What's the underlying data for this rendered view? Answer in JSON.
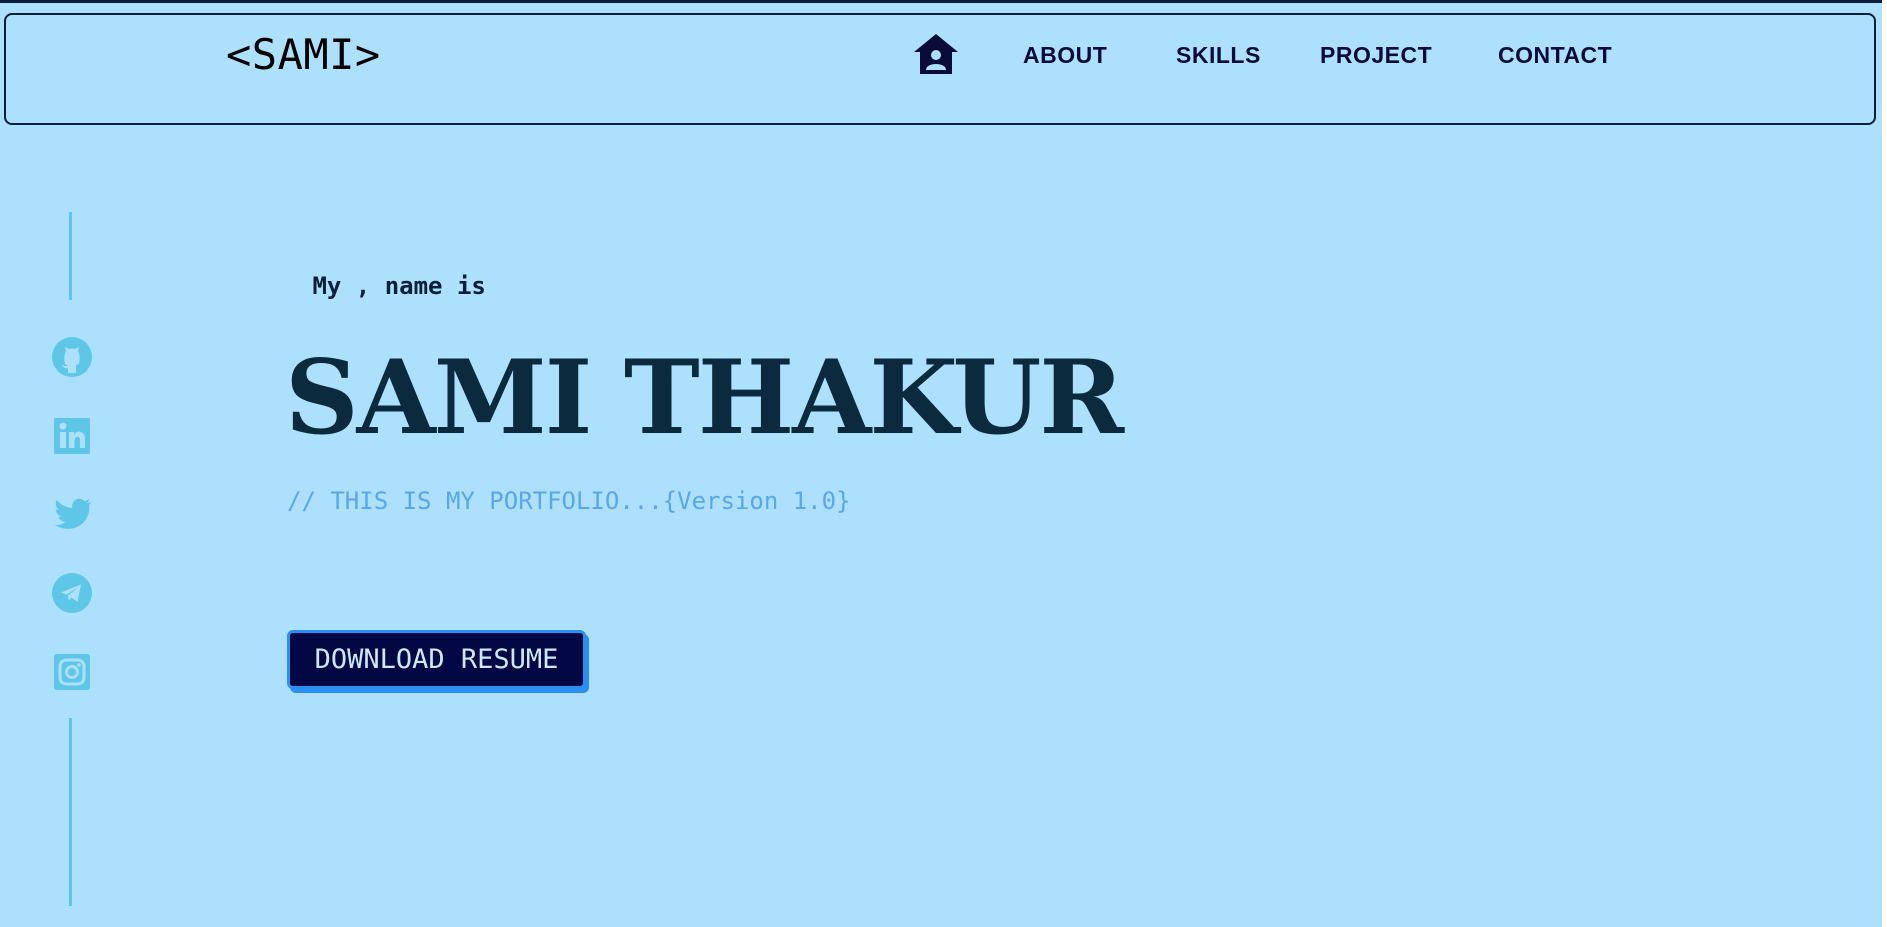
{
  "header": {
    "logo": "<SAMI>",
    "home_icon": "home-user-icon",
    "links": [
      "ABOUT",
      "SKILLS",
      "PROJECT",
      "CONTACT"
    ]
  },
  "social": {
    "icons": [
      "github-icon",
      "linkedin-icon",
      "twitter-icon",
      "telegram-icon",
      "instagram-icon"
    ],
    "color": "#5ec7e8"
  },
  "hero": {
    "intro": " My , name is",
    "name": "SAMI THAKUR",
    "tagline": "// THIS IS MY PORTFOLIO...{Version 1.0}",
    "resume_button": "DOWNLOAD RESUME"
  },
  "colors": {
    "background": "#ade0fd",
    "navy": "#0b0b3a",
    "accent_blue": "#2a8ff0",
    "tagline": "#59a7e8"
  }
}
